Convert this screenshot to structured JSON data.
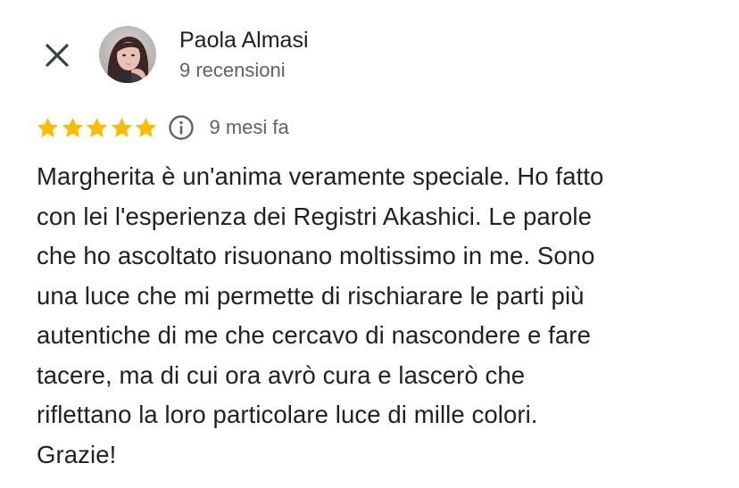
{
  "review": {
    "reviewer_name": "Paola Almasi",
    "review_count": "9 recensioni",
    "rating": 5,
    "rating_max": 5,
    "time_ago": "9 mesi fa",
    "text": "Margherita è un'anima veramente speciale. Ho fatto\ncon lei l'esperienza dei Registri Akashici. Le parole\nche ho ascoltato risuonano moltissimo in me. Sono\nuna luce che mi permette di rischiarare le parti più\nautentiche di me che cercavo di nascondere e fare\ntacere, ma di cui ora avrò cura e lascerò che\nriflettano la loro particolare luce di mille colori.\nGrazie!"
  },
  "icons": {
    "close": "close-icon",
    "info": "info-icon",
    "star": "star-icon"
  },
  "colors": {
    "star": "#fbbc04",
    "text_primary": "#202124",
    "text_secondary": "#5f6368",
    "icon": "#3c4043"
  }
}
